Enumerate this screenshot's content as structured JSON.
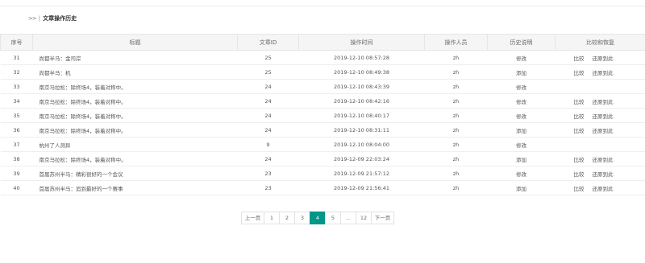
{
  "breadcrumb": {
    "arrow": ">>",
    "separator": "|",
    "title": "文章操作历史"
  },
  "table": {
    "headers": [
      "序号",
      "标题",
      "文章ID",
      "操作时间",
      "操作人员",
      "历史说明",
      "比较和恢复"
    ],
    "rows": [
      {
        "id": "31",
        "title": "尚都半马：金司岸",
        "article_id": "25",
        "time": "2019-12-10 08:57:28",
        "user": "zh",
        "note": "修改",
        "compare": "比较",
        "restore": "还原到此"
      },
      {
        "id": "32",
        "title": "尚都半马：机",
        "article_id": "25",
        "time": "2019-12-10 08:49:38",
        "user": "zh",
        "note": "添加",
        "compare": "比较",
        "restore": "还原到此"
      },
      {
        "id": "33",
        "title": "南京马拉松：除终场4，装着对称中。",
        "article_id": "24",
        "time": "2019-12-10 08:43:39",
        "user": "zh",
        "note": "修改",
        "compare": "",
        "restore": ""
      },
      {
        "id": "34",
        "title": "南京马拉松：除终场4，装着对称中。",
        "article_id": "24",
        "time": "2019-12-10 08:42:16",
        "user": "zh",
        "note": "修改",
        "compare": "比较",
        "restore": "还原到此"
      },
      {
        "id": "35",
        "title": "南京马拉松：除终场4，装着对称中。",
        "article_id": "24",
        "time": "2019-12-10 08:40:17",
        "user": "zh",
        "note": "修改",
        "compare": "比较",
        "restore": "还原到此"
      },
      {
        "id": "36",
        "title": "南京马拉松：除终场4，装着对称中。",
        "article_id": "24",
        "time": "2019-12-10 08:31:11",
        "user": "zh",
        "note": "添加",
        "compare": "比较",
        "restore": "还原到此"
      },
      {
        "id": "37",
        "title": "杭州了人测异",
        "article_id": "9",
        "time": "2019-12-10 08:04:00",
        "user": "zh",
        "note": "修改",
        "compare": "",
        "restore": ""
      },
      {
        "id": "38",
        "title": "南京马拉松：除终场4，装着对称中。",
        "article_id": "24",
        "time": "2019-12-09 22:03:24",
        "user": "zh",
        "note": "添加",
        "compare": "比较",
        "restore": "还原到此"
      },
      {
        "id": "39",
        "title": "首届苏州半马：精彩很好的一个会议",
        "article_id": "23",
        "time": "2019-12-09 21:57:12",
        "user": "zh",
        "note": "修改",
        "compare": "比较",
        "restore": "还原到此"
      },
      {
        "id": "40",
        "title": "首届苏州半马：追到最好的一个赛事",
        "article_id": "23",
        "time": "2019-12-09 21:56:41",
        "user": "zh",
        "note": "添加",
        "compare": "比较",
        "restore": "还原到此"
      }
    ]
  },
  "pagination": {
    "prev": "上一页",
    "next": "下一页",
    "pages": [
      "1",
      "2",
      "3",
      "4",
      "5",
      "...",
      "12"
    ],
    "active": "4"
  }
}
